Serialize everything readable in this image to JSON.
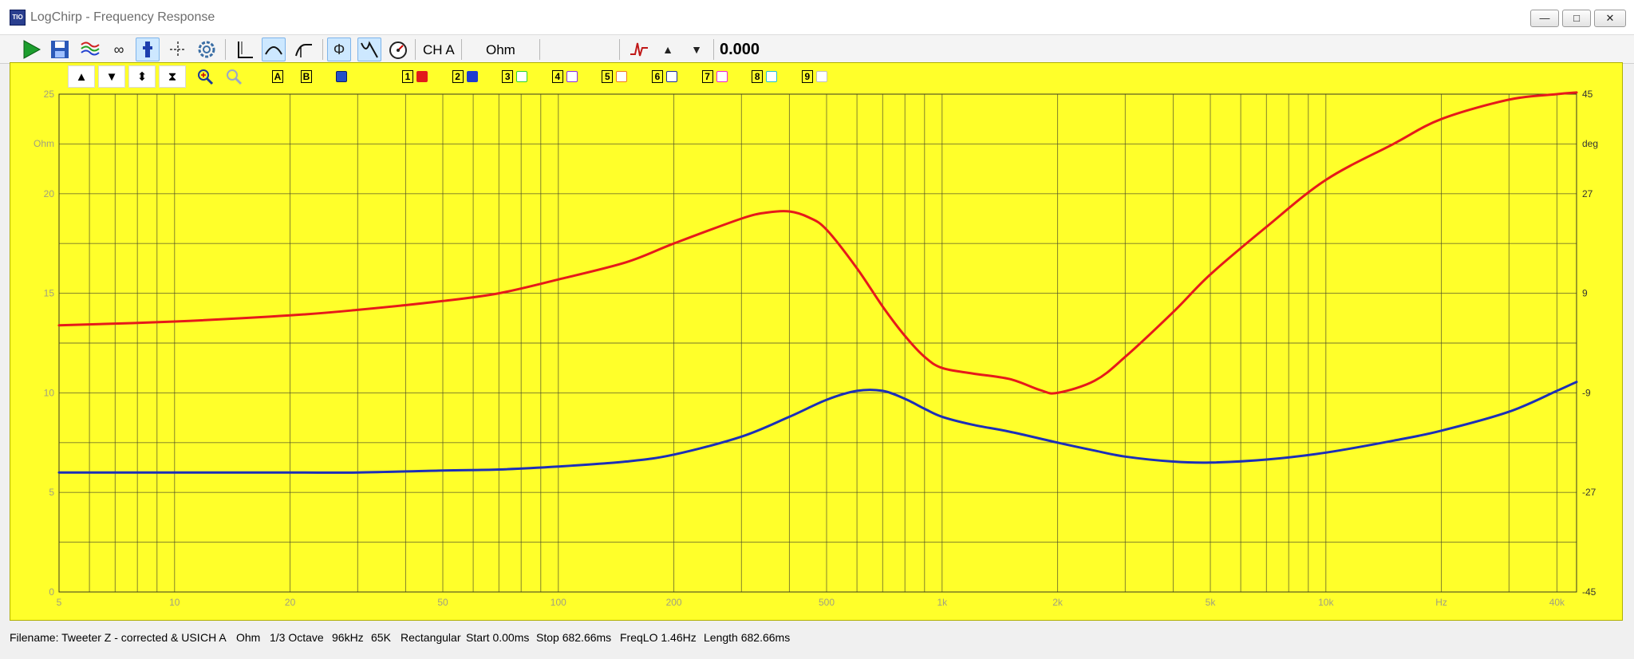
{
  "window": {
    "title": "LogChirp - Frequency Response",
    "app_icon_text": "TIO",
    "minimize_label": "—",
    "maximize_label": "□",
    "close_label": "✕"
  },
  "toolbar": {
    "channel_label": "CH A",
    "unit_label": "Ohm",
    "value_readout": "0.000"
  },
  "chart_toolbar": {
    "marker_a": "A",
    "marker_b": "B",
    "slots": [
      "1",
      "2",
      "3",
      "4",
      "5",
      "6",
      "7",
      "8",
      "9"
    ],
    "slot_colors": [
      "#e21b1b",
      "#1f3bd0",
      "#2ad42a",
      "#8a2be2",
      "#f07a1a",
      "#1a2a9a",
      "#f020d0",
      "#20c0d0",
      "#c0c0c0"
    ]
  },
  "chart_data": {
    "type": "line",
    "x_scale": "log",
    "xlim": [
      5,
      45000
    ],
    "x_ticks": [
      5,
      10,
      20,
      50,
      100,
      200,
      500,
      1000,
      2000,
      5000,
      10000,
      40000
    ],
    "x_tick_labels": [
      "5",
      "10",
      "20",
      "50",
      "100",
      "200",
      "500",
      "1k",
      "2k",
      "5k",
      "10k",
      "40k"
    ],
    "x_unit_label": "Hz",
    "y_left": {
      "lim": [
        0,
        25
      ],
      "ticks": [
        0,
        5,
        10,
        15,
        20,
        25
      ],
      "tick_labels": [
        "0",
        "5",
        "10",
        "15",
        "20",
        "25"
      ],
      "unit": "Ohm"
    },
    "y_right": {
      "lim": [
        -45,
        45
      ],
      "ticks": [
        -45,
        -27,
        -9,
        9,
        27,
        45
      ],
      "tick_labels": [
        "-45",
        "-27",
        "-9",
        "9",
        "27",
        "45"
      ],
      "unit": "deg"
    },
    "grid": true,
    "background": "#ffff2a",
    "series": [
      {
        "axis": "right",
        "color": "#e61a1a",
        "x": [
          5,
          10,
          20,
          30,
          50,
          70,
          100,
          150,
          200,
          300,
          350,
          400,
          450,
          500,
          600,
          700,
          800,
          900,
          1000,
          1200,
          1500,
          1800,
          2000,
          2500,
          3000,
          4000,
          5000,
          7000,
          10000,
          15000,
          20000,
          30000,
          40000,
          45000
        ],
        "y": [
          3.2,
          3.9,
          5,
          6,
          7.6,
          9,
          11.5,
          14.6,
          18,
          22.5,
          23.6,
          23.8,
          22.7,
          20.5,
          13.5,
          6.6,
          1.3,
          -2.5,
          -4.5,
          -5.5,
          -6.5,
          -8.5,
          -9,
          -6.8,
          -2.5,
          5.6,
          12.4,
          21,
          29.5,
          36,
          40.5,
          44,
          45,
          45.3
        ]
      },
      {
        "axis": "left",
        "color": "#1c2fb8",
        "x": [
          5,
          10,
          20,
          30,
          50,
          70,
          100,
          150,
          200,
          300,
          400,
          500,
          600,
          700,
          800,
          900,
          1000,
          1200,
          1500,
          2000,
          2500,
          3000,
          4000,
          5000,
          7000,
          10000,
          15000,
          20000,
          30000,
          40000,
          45000
        ],
        "y": [
          6.0,
          6.0,
          6.0,
          6.0,
          6.1,
          6.15,
          6.3,
          6.55,
          6.9,
          7.8,
          8.8,
          9.65,
          10.1,
          10.1,
          9.7,
          9.2,
          8.8,
          8.4,
          8.05,
          7.5,
          7.1,
          6.8,
          6.55,
          6.5,
          6.65,
          7.0,
          7.6,
          8.1,
          9.05,
          10.1,
          10.55
        ]
      }
    ]
  },
  "status": {
    "filename": "Filename: Tweeter Z - corrected & USI",
    "channel": "CH A",
    "unit": "Ohm",
    "smoothing": "1/3 Octave",
    "sample_rate": "96kHz",
    "fft_size": "65K",
    "window": "Rectangular",
    "start": "Start 0.00ms",
    "stop": "Stop 682.66ms",
    "freq_lo": "FreqLO 1.46Hz",
    "length": "Length 682.66ms"
  }
}
